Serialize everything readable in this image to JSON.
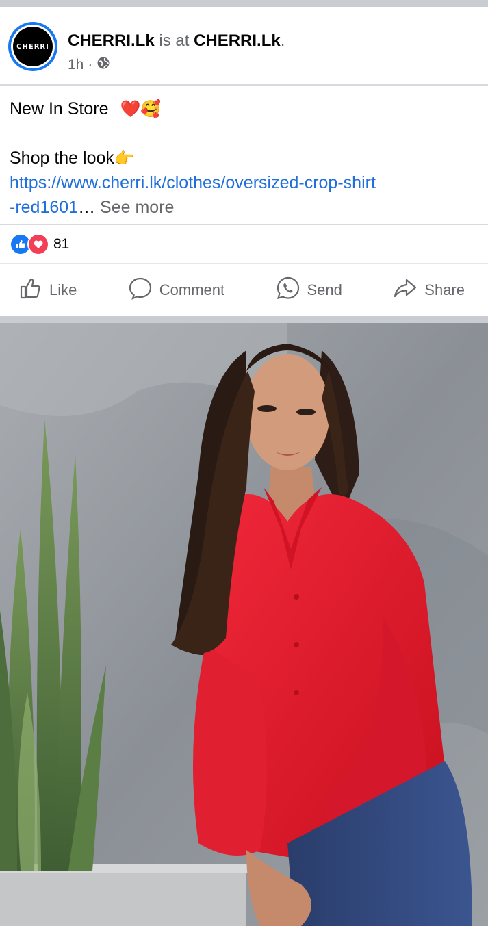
{
  "post": {
    "page_name": "CHERRI.Lk",
    "is_at": "is at",
    "location": "CHERRI.Lk",
    "period": ".",
    "time": "1h",
    "separator": "·",
    "avatar_text": "CHERRI",
    "privacy_icon": "globe-icon"
  },
  "content": {
    "line1": "New In Store",
    "line1_emoji": "❤️🥰",
    "line2": "Shop the look",
    "line2_emoji": "👉",
    "link_line1": "https://www.cherri.lk/clothes/oversized-crop-shirt",
    "link_line2": "-red1601",
    "ellipsis": "…",
    "see_more": "See more"
  },
  "reactions": {
    "count": "81",
    "icons": [
      "like-reaction-icon",
      "love-reaction-icon"
    ]
  },
  "actions": {
    "like": "Like",
    "comment": "Comment",
    "send": "Send",
    "share": "Share"
  },
  "colors": {
    "brand_blue": "#1877f2",
    "link": "#216fdb",
    "muted": "#65676b",
    "love": "#f33e58",
    "shirt_red": "#e31b2e"
  }
}
